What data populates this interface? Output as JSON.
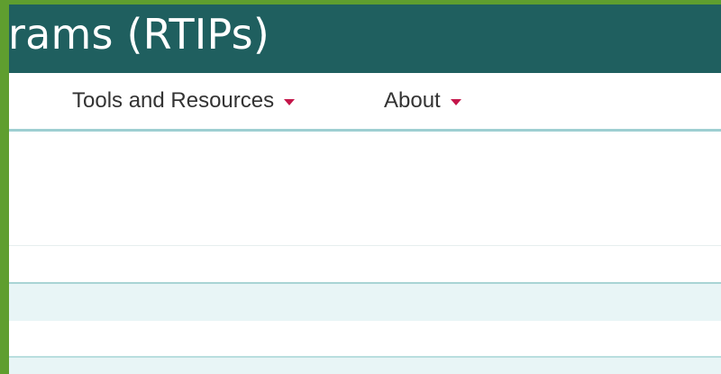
{
  "header": {
    "title_fragment": "rams (RTIPs)"
  },
  "nav": {
    "items": [
      {
        "label": "Tools and Resources",
        "icon": "caret-down-icon"
      },
      {
        "label": "About",
        "icon": "caret-down-icon"
      }
    ]
  },
  "annotation": {
    "arrow_color": "#d4821e",
    "icon": "arrow-right-icon"
  },
  "colors": {
    "frame": "#5f9e2f",
    "banner": "#1f5f5f",
    "caret": "#c4164a",
    "nav_border": "#9ecfd2",
    "row_stripe": "#e8f5f6"
  }
}
